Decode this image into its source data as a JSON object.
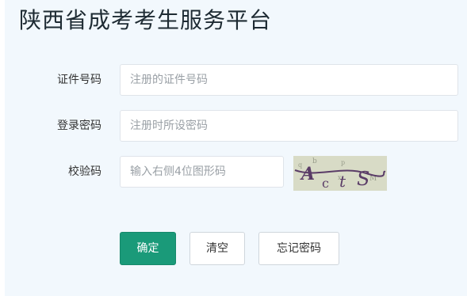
{
  "page": {
    "title": "陕西省成考考生服务平台"
  },
  "form": {
    "id_label": "证件号码",
    "id_placeholder": "注册的证件号码",
    "password_label": "登录密码",
    "password_placeholder": "注册时所设密码",
    "captcha_label": "校验码",
    "captcha_placeholder": "输入右侧4位图形码",
    "captcha_text": "ActS"
  },
  "buttons": {
    "confirm": "确定",
    "clear": "清空",
    "forgot_password": "忘记密码"
  },
  "colors": {
    "panel_background": "#f2f8fd",
    "primary": "#1a9a79"
  }
}
